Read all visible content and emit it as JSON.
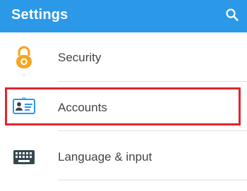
{
  "header": {
    "title": "Settings",
    "search_icon": "search-icon",
    "background_color": "#2b98e8",
    "text_color": "#ffffff"
  },
  "settings_items": [
    {
      "label": "Security",
      "icon": "padlock-icon",
      "icon_color": "#f5a623"
    },
    {
      "label": "Accounts",
      "icon": "id-card-icon",
      "icon_color": "#2b98e8"
    },
    {
      "label": "Language & input",
      "icon": "keyboard-icon",
      "icon_color": "#37474f"
    }
  ],
  "highlight": {
    "target": "Accounts",
    "color": "#e0262e"
  }
}
